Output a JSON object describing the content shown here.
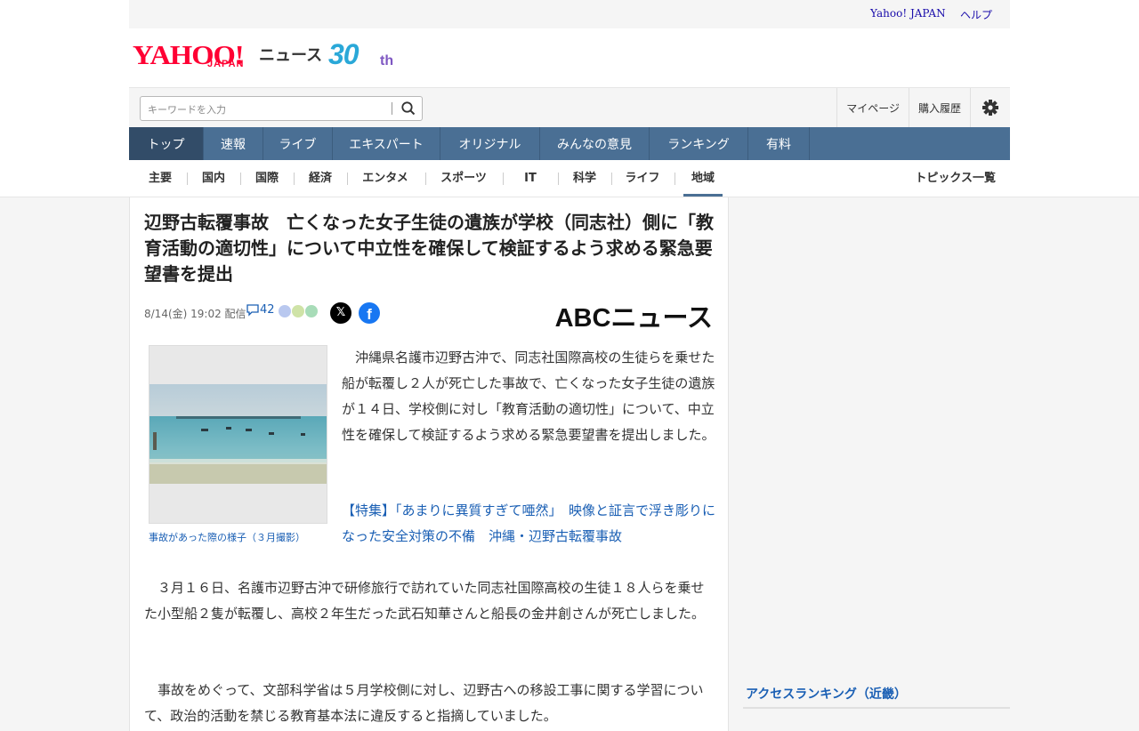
{
  "util": {
    "yahoo_japan": "Yahoo! JAPAN",
    "help": "ヘルプ"
  },
  "logo": {
    "yahoo": "YAHOO!",
    "japan": "JAPAN",
    "news": "ニュース",
    "anniv": "30",
    "anniv_suffix": "th"
  },
  "search": {
    "placeholder": "キーワードを入力",
    "value": ""
  },
  "header_links": {
    "mypage": "マイページ",
    "history": "購入履歴"
  },
  "main_nav": [
    "トップ",
    "速報",
    "ライブ",
    "エキスパート",
    "オリジナル",
    "みんなの意見",
    "ランキング",
    "有料"
  ],
  "sub_nav": [
    "主要",
    "国内",
    "国際",
    "経済",
    "エンタメ",
    "スポーツ",
    "IT",
    "科学",
    "ライフ",
    "地域"
  ],
  "sub_nav_active": "地域",
  "topics_link": "トピックス一覧",
  "article": {
    "title": "辺野古転覆事故　亡くなった女子生徒の遺族が学校（同志社）側に「教育活動の適切性」について中立性を確保して検証するよう求める緊急要望書を提出",
    "datetime": "8/14(金) 19:02",
    "delivery": "配信",
    "comments": "42",
    "source": "ABCニュース",
    "photo_caption": "事故があった際の様子（３月撮影）",
    "lead": "　沖縄県名護市辺野古沖で、同志社国際高校の生徒らを乗せた船が転覆し２人が死亡した事故で、亡くなった女子生徒の遺族が１４日、学校側に対し「教育活動の適切性」について、中立性を確保して検証するよう求める緊急要望書を提出しました。",
    "feature_link": "【特集】｢あまりに異質すぎて唖然｣　映像と証言で浮き彫りになった安全対策の不備　沖縄・辺野古転覆事故",
    "para2": "　３月１６日、名護市辺野古沖で研修旅行で訪れていた同志社国際高校の生徒１８人らを乗せた小型船２隻が転覆し、高校２年生だった武石知華さんと船長の金井創さんが死亡しました。",
    "para3": "　事故をめぐって、文部科学省は５月学校側に対し、辺野古への移設工事に関する学習について、政治的活動を禁じる教育基本法に違反すると指摘していました。"
  },
  "sidebar": {
    "ranking_title": "アクセスランキング（近畿）"
  },
  "colors": {
    "nav_bg": "#4a6f94",
    "nav_active": "#324c68",
    "link": "#1a5fb4",
    "brand_red": "#ff0033"
  }
}
